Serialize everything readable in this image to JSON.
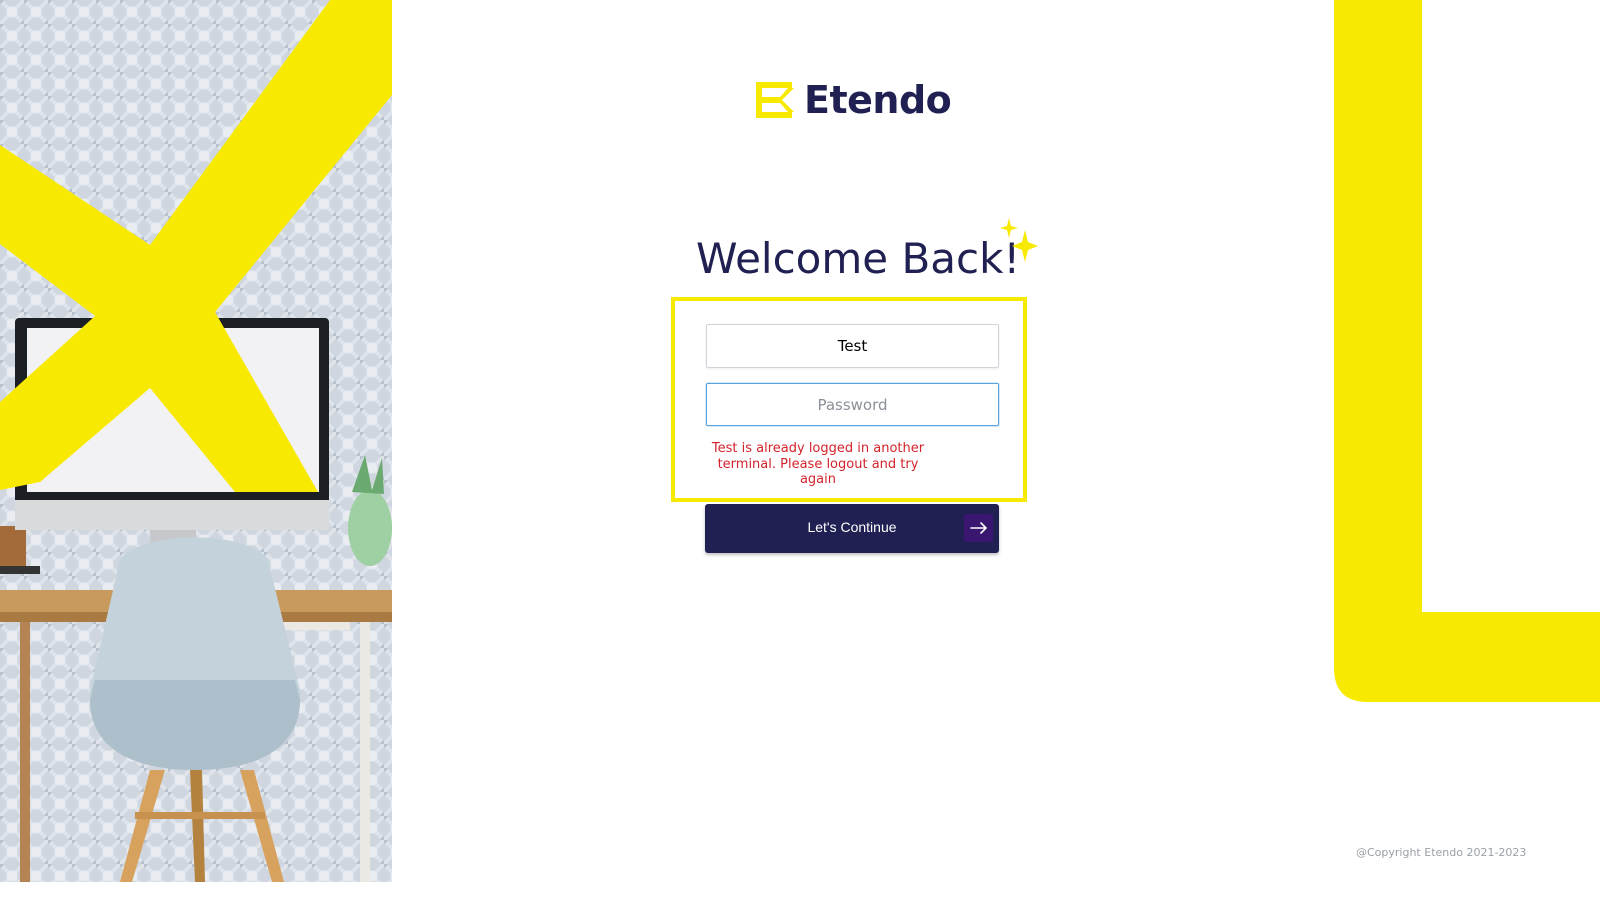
{
  "brand": {
    "name": "Etendo",
    "accent_color": "#f7ea00",
    "primary_color": "#202052",
    "logo_icon": "etendo-logo-icon"
  },
  "heading": {
    "title": "Welcome Back!",
    "sparkle_icon": "sparkle-icon"
  },
  "form": {
    "username_value": "Test",
    "password_placeholder": "Password",
    "error_message": "Test is already logged in another terminal. Please logout and try again",
    "submit_label": "Let's Continue",
    "submit_icon": "arrow-right-icon"
  },
  "footer": {
    "copyright": "@Copyright Etendo 2021-2023"
  }
}
